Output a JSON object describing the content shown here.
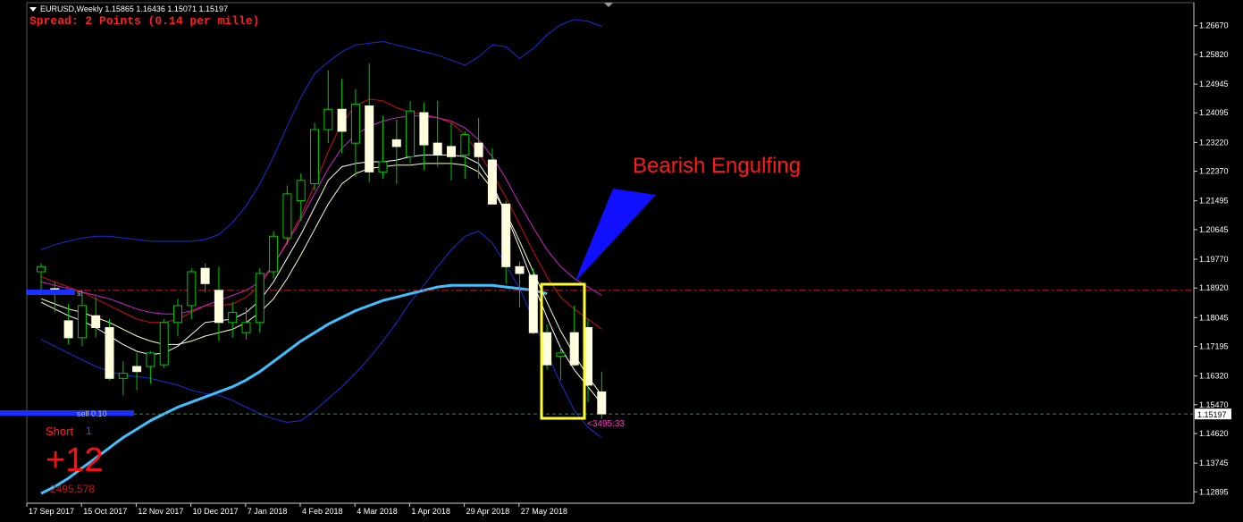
{
  "header": {
    "symbol_line": "EURUSD,Weekly  1.15865 1.16436 1.15071 1.15197",
    "spread_line": "Spread: 2 Points (0.14 per mille)"
  },
  "overlay": {
    "short_label": "Short",
    "short_count": "1",
    "profit_points": "+12",
    "profit_small": "2495.578",
    "trade_label_1": "s!",
    "trade_label_2": "sell 0.10"
  },
  "annotation": {
    "text": "Bearish Engulfing",
    "color": "#ff1a1a"
  },
  "colors": {
    "background": "#000000",
    "bull_candle": "#00c800",
    "bear_candle_fill": "#ffffe0",
    "bollinger": "#1a2cd8",
    "ma_red": "#cc1010",
    "ma_magenta": "#d020d0",
    "ma_white": "#ffffff",
    "ma_yellow": "#ffffc0",
    "ma_cyan": "#40c0ff",
    "current_price_line": "#2e8b57",
    "resistance_line": "#cc2020",
    "highlight_box": "#ffff30",
    "arrow": "#1010ff"
  },
  "chart_data": {
    "type": "candlestick",
    "symbol": "EURUSD",
    "timeframe": "Weekly",
    "y_axis": {
      "ylim": [
        1.1256,
        1.2735
      ],
      "ticks": [
        "1.26670",
        "1.25820",
        "1.24945",
        "1.24095",
        "1.23220",
        "1.22370",
        "1.21495",
        "1.20645",
        "1.19770",
        "1.18920",
        "1.18045",
        "1.17195",
        "1.16320",
        "1.15470",
        "1.14620",
        "1.13745",
        "1.12895"
      ],
      "current_price": "1.15197",
      "current_price_value": 1.15197
    },
    "x_axis": {
      "labels": [
        {
          "text": "17 Sep 2017",
          "index": 0
        },
        {
          "text": "15 Oct 2017",
          "index": 4
        },
        {
          "text": "12 Nov 2017",
          "index": 8
        },
        {
          "text": "10 Dec 2017",
          "index": 12
        },
        {
          "text": "7 Jan 2018",
          "index": 16
        },
        {
          "text": "4 Feb 2018",
          "index": 20
        },
        {
          "text": "4 Mar 2018",
          "index": 24
        },
        {
          "text": "1 Apr 2018",
          "index": 28
        },
        {
          "text": "29 Apr 2018",
          "index": 32
        },
        {
          "text": "27 May 2018",
          "index": 36
        }
      ]
    },
    "candles": [
      {
        "o": 1.194,
        "h": 1.1965,
        "l": 1.1875,
        "c": 1.1955
      },
      {
        "o": 1.189,
        "h": 1.191,
        "l": 1.182,
        "c": 1.188
      },
      {
        "o": 1.1795,
        "h": 1.1845,
        "l": 1.1725,
        "c": 1.1745
      },
      {
        "o": 1.1745,
        "h": 1.188,
        "l": 1.172,
        "c": 1.184
      },
      {
        "o": 1.181,
        "h": 1.1865,
        "l": 1.1745,
        "c": 1.1775
      },
      {
        "o": 1.1775,
        "h": 1.18,
        "l": 1.162,
        "c": 1.1625
      },
      {
        "o": 1.1625,
        "h": 1.1675,
        "l": 1.1575,
        "c": 1.164
      },
      {
        "o": 1.166,
        "h": 1.17,
        "l": 1.159,
        "c": 1.1645
      },
      {
        "o": 1.166,
        "h": 1.1705,
        "l": 1.161,
        "c": 1.17
      },
      {
        "o": 1.1665,
        "h": 1.18,
        "l": 1.1655,
        "c": 1.179
      },
      {
        "o": 1.179,
        "h": 1.186,
        "l": 1.175,
        "c": 1.184
      },
      {
        "o": 1.184,
        "h": 1.195,
        "l": 1.18,
        "c": 1.194
      },
      {
        "o": 1.195,
        "h": 1.1965,
        "l": 1.188,
        "c": 1.1905
      },
      {
        "o": 1.1885,
        "h": 1.1955,
        "l": 1.1735,
        "c": 1.179
      },
      {
        "o": 1.179,
        "h": 1.185,
        "l": 1.1745,
        "c": 1.182
      },
      {
        "o": 1.176,
        "h": 1.1835,
        "l": 1.174,
        "c": 1.179
      },
      {
        "o": 1.179,
        "h": 1.195,
        "l": 1.176,
        "c": 1.1935
      },
      {
        "o": 1.194,
        "h": 1.206,
        "l": 1.192,
        "c": 1.2045
      },
      {
        "o": 1.204,
        "h": 1.2195,
        "l": 1.202,
        "c": 1.217
      },
      {
        "o": 1.215,
        "h": 1.223,
        "l": 1.209,
        "c": 1.221
      },
      {
        "o": 1.22,
        "h": 1.238,
        "l": 1.218,
        "c": 1.236
      },
      {
        "o": 1.236,
        "h": 1.2535,
        "l": 1.232,
        "c": 1.242
      },
      {
        "o": 1.242,
        "h": 1.251,
        "l": 1.229,
        "c": 1.2355
      },
      {
        "o": 1.232,
        "h": 1.248,
        "l": 1.222,
        "c": 1.2435
      },
      {
        "o": 1.243,
        "h": 1.2555,
        "l": 1.2205,
        "c": 1.2235
      },
      {
        "o": 1.2235,
        "h": 1.24,
        "l": 1.2215,
        "c": 1.2265
      },
      {
        "o": 1.233,
        "h": 1.239,
        "l": 1.22,
        "c": 1.231
      },
      {
        "o": 1.228,
        "h": 1.2445,
        "l": 1.226,
        "c": 1.2415
      },
      {
        "o": 1.241,
        "h": 1.244,
        "l": 1.224,
        "c": 1.2315
      },
      {
        "o": 1.232,
        "h": 1.2445,
        "l": 1.225,
        "c": 1.2285
      },
      {
        "o": 1.231,
        "h": 1.238,
        "l": 1.221,
        "c": 1.228
      },
      {
        "o": 1.2285,
        "h": 1.2355,
        "l": 1.2215,
        "c": 1.2345
      },
      {
        "o": 1.232,
        "h": 1.2395,
        "l": 1.2215,
        "c": 1.228
      },
      {
        "o": 1.227,
        "h": 1.2305,
        "l": 1.2145,
        "c": 1.214
      },
      {
        "o": 1.214,
        "h": 1.215,
        "l": 1.1905,
        "c": 1.1955
      },
      {
        "o": 1.1955,
        "h": 1.197,
        "l": 1.1835,
        "c": 1.1935
      },
      {
        "o": 1.193,
        "h": 1.195,
        "l": 1.1755,
        "c": 1.176
      },
      {
        "o": 1.176,
        "h": 1.1785,
        "l": 1.165,
        "c": 1.1665
      },
      {
        "o": 1.169,
        "h": 1.172,
        "l": 1.162,
        "c": 1.17
      },
      {
        "o": 1.176,
        "h": 1.184,
        "l": 1.166,
        "c": 1.1665
      },
      {
        "o": 1.1775,
        "h": 1.18,
        "l": 1.1555,
        "c": 1.1605
      },
      {
        "o": 1.1585,
        "h": 1.1645,
        "l": 1.1505,
        "c": 1.152
      }
    ],
    "indicators": {
      "bb_upper": [
        1.2005,
        1.202,
        1.203,
        1.204,
        1.2045,
        1.2045,
        1.204,
        1.2035,
        1.203,
        1.203,
        1.203,
        1.203,
        1.2035,
        1.205,
        1.2085,
        1.2135,
        1.22,
        1.228,
        1.237,
        1.2455,
        1.2525,
        1.256,
        1.259,
        1.261,
        1.2615,
        1.262,
        1.261,
        1.26,
        1.259,
        1.258,
        1.2565,
        1.255,
        1.2575,
        1.261,
        1.2605,
        1.257,
        1.26,
        1.264,
        1.267,
        1.2685,
        1.268,
        1.2665
      ],
      "bb_lower": [
        1.174,
        1.172,
        1.17,
        1.168,
        1.166,
        1.1645,
        1.1635,
        1.163,
        1.1625,
        1.1615,
        1.1605,
        1.159,
        1.158,
        1.1575,
        1.156,
        1.154,
        1.152,
        1.1505,
        1.1495,
        1.15,
        1.153,
        1.1565,
        1.16,
        1.164,
        1.1685,
        1.1735,
        1.179,
        1.185,
        1.19,
        1.1955,
        1.2005,
        1.2045,
        1.206,
        1.2025,
        1.196,
        1.189,
        1.18,
        1.17,
        1.161,
        1.153,
        1.148,
        1.145
      ],
      "ma_red": [
        1.1925,
        1.191,
        1.1895,
        1.188,
        1.186,
        1.184,
        1.182,
        1.18,
        1.179,
        1.179,
        1.18,
        1.182,
        1.184,
        1.184,
        1.1845,
        1.1865,
        1.19,
        1.196,
        1.203,
        1.2105,
        1.2195,
        1.2295,
        1.238,
        1.243,
        1.245,
        1.2445,
        1.2425,
        1.241,
        1.2405,
        1.2395,
        1.238,
        1.2345,
        1.229,
        1.223,
        1.216,
        1.208,
        1.2,
        1.1925,
        1.1865,
        1.183,
        1.18,
        1.177
      ],
      "ma_magenta": [
        1.191,
        1.19,
        1.189,
        1.188,
        1.187,
        1.186,
        1.1845,
        1.183,
        1.182,
        1.1815,
        1.1815,
        1.1825,
        1.184,
        1.1855,
        1.187,
        1.1885,
        1.191,
        1.196,
        1.2025,
        1.2095,
        1.217,
        1.2245,
        1.2305,
        1.2345,
        1.237,
        1.2385,
        1.2395,
        1.24,
        1.24,
        1.2395,
        1.2385,
        1.2365,
        1.233,
        1.228,
        1.2215,
        1.214,
        1.207,
        1.2005,
        1.1955,
        1.192,
        1.1895,
        1.187
      ],
      "ma_white": [
        1.185,
        1.183,
        1.181,
        1.1795,
        1.1775,
        1.175,
        1.1725,
        1.1705,
        1.1695,
        1.17,
        1.172,
        1.1755,
        1.179,
        1.1795,
        1.18,
        1.182,
        1.1855,
        1.191,
        1.198,
        1.205,
        1.213,
        1.221,
        1.225,
        1.226,
        1.2265,
        1.2265,
        1.227,
        1.228,
        1.2285,
        1.2285,
        1.2285,
        1.228,
        1.226,
        1.22,
        1.211,
        1.201,
        1.1905,
        1.1805,
        1.1715,
        1.165,
        1.16,
        1.155
      ],
      "ma_yellow": [
        1.186,
        1.1845,
        1.183,
        1.182,
        1.1805,
        1.179,
        1.177,
        1.175,
        1.1735,
        1.1725,
        1.1725,
        1.1735,
        1.175,
        1.176,
        1.177,
        1.179,
        1.182,
        1.186,
        1.192,
        1.199,
        1.2065,
        1.214,
        1.22,
        1.223,
        1.2245,
        1.225,
        1.2255,
        1.2255,
        1.226,
        1.226,
        1.226,
        1.2255,
        1.2235,
        1.2185,
        1.2115,
        1.203,
        1.194,
        1.185,
        1.1765,
        1.1695,
        1.163,
        1.1575
      ],
      "ma_cyan": [
        1.1285,
        1.1305,
        1.133,
        1.136,
        1.139,
        1.142,
        1.145,
        1.1475,
        1.15,
        1.152,
        1.154,
        1.1555,
        1.157,
        1.1585,
        1.16,
        1.162,
        1.1645,
        1.1675,
        1.1705,
        1.1735,
        1.176,
        1.1785,
        1.1805,
        1.1825,
        1.184,
        1.1855,
        1.1865,
        1.1875,
        1.1885,
        1.1895,
        1.19,
        1.19,
        1.19,
        1.19,
        1.1895,
        1.189,
        1.1885,
        1.1875
      ]
    },
    "horizontal_lines": {
      "resistance": 1.1885,
      "current_price": 1.15197
    },
    "title": "",
    "xlabel": "",
    "ylabel": "",
    "grid": false,
    "legend": false
  }
}
